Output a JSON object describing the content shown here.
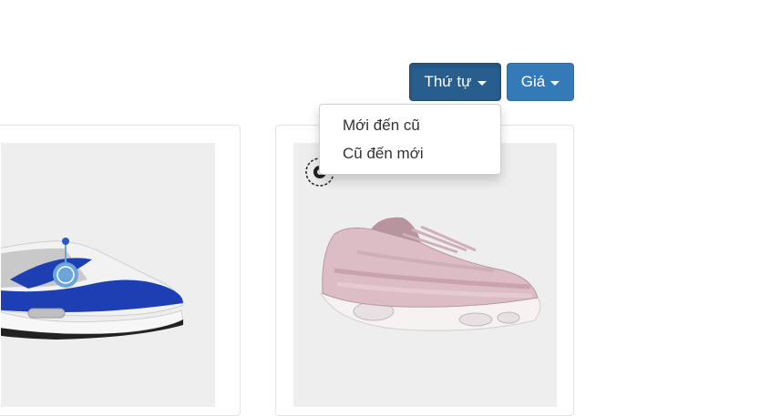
{
  "toolbar": {
    "sort_button_label": "Thứ tự",
    "price_button_label": "Giá"
  },
  "sort_menu": {
    "items": [
      {
        "label": "Mới đến cũ"
      },
      {
        "label": "Cũ đến mới"
      }
    ]
  },
  "products": [
    {
      "image": "blue-white-sneaker",
      "colors": {
        "accent": "#1e3fb4",
        "base": "#f4f4f4"
      }
    },
    {
      "image": "pink-sneaker",
      "colors": {
        "accent": "#d9b8c2",
        "base": "#f0f0f0"
      }
    }
  ],
  "colors": {
    "primary": "#337ab7",
    "primary_active": "#285e8e"
  }
}
